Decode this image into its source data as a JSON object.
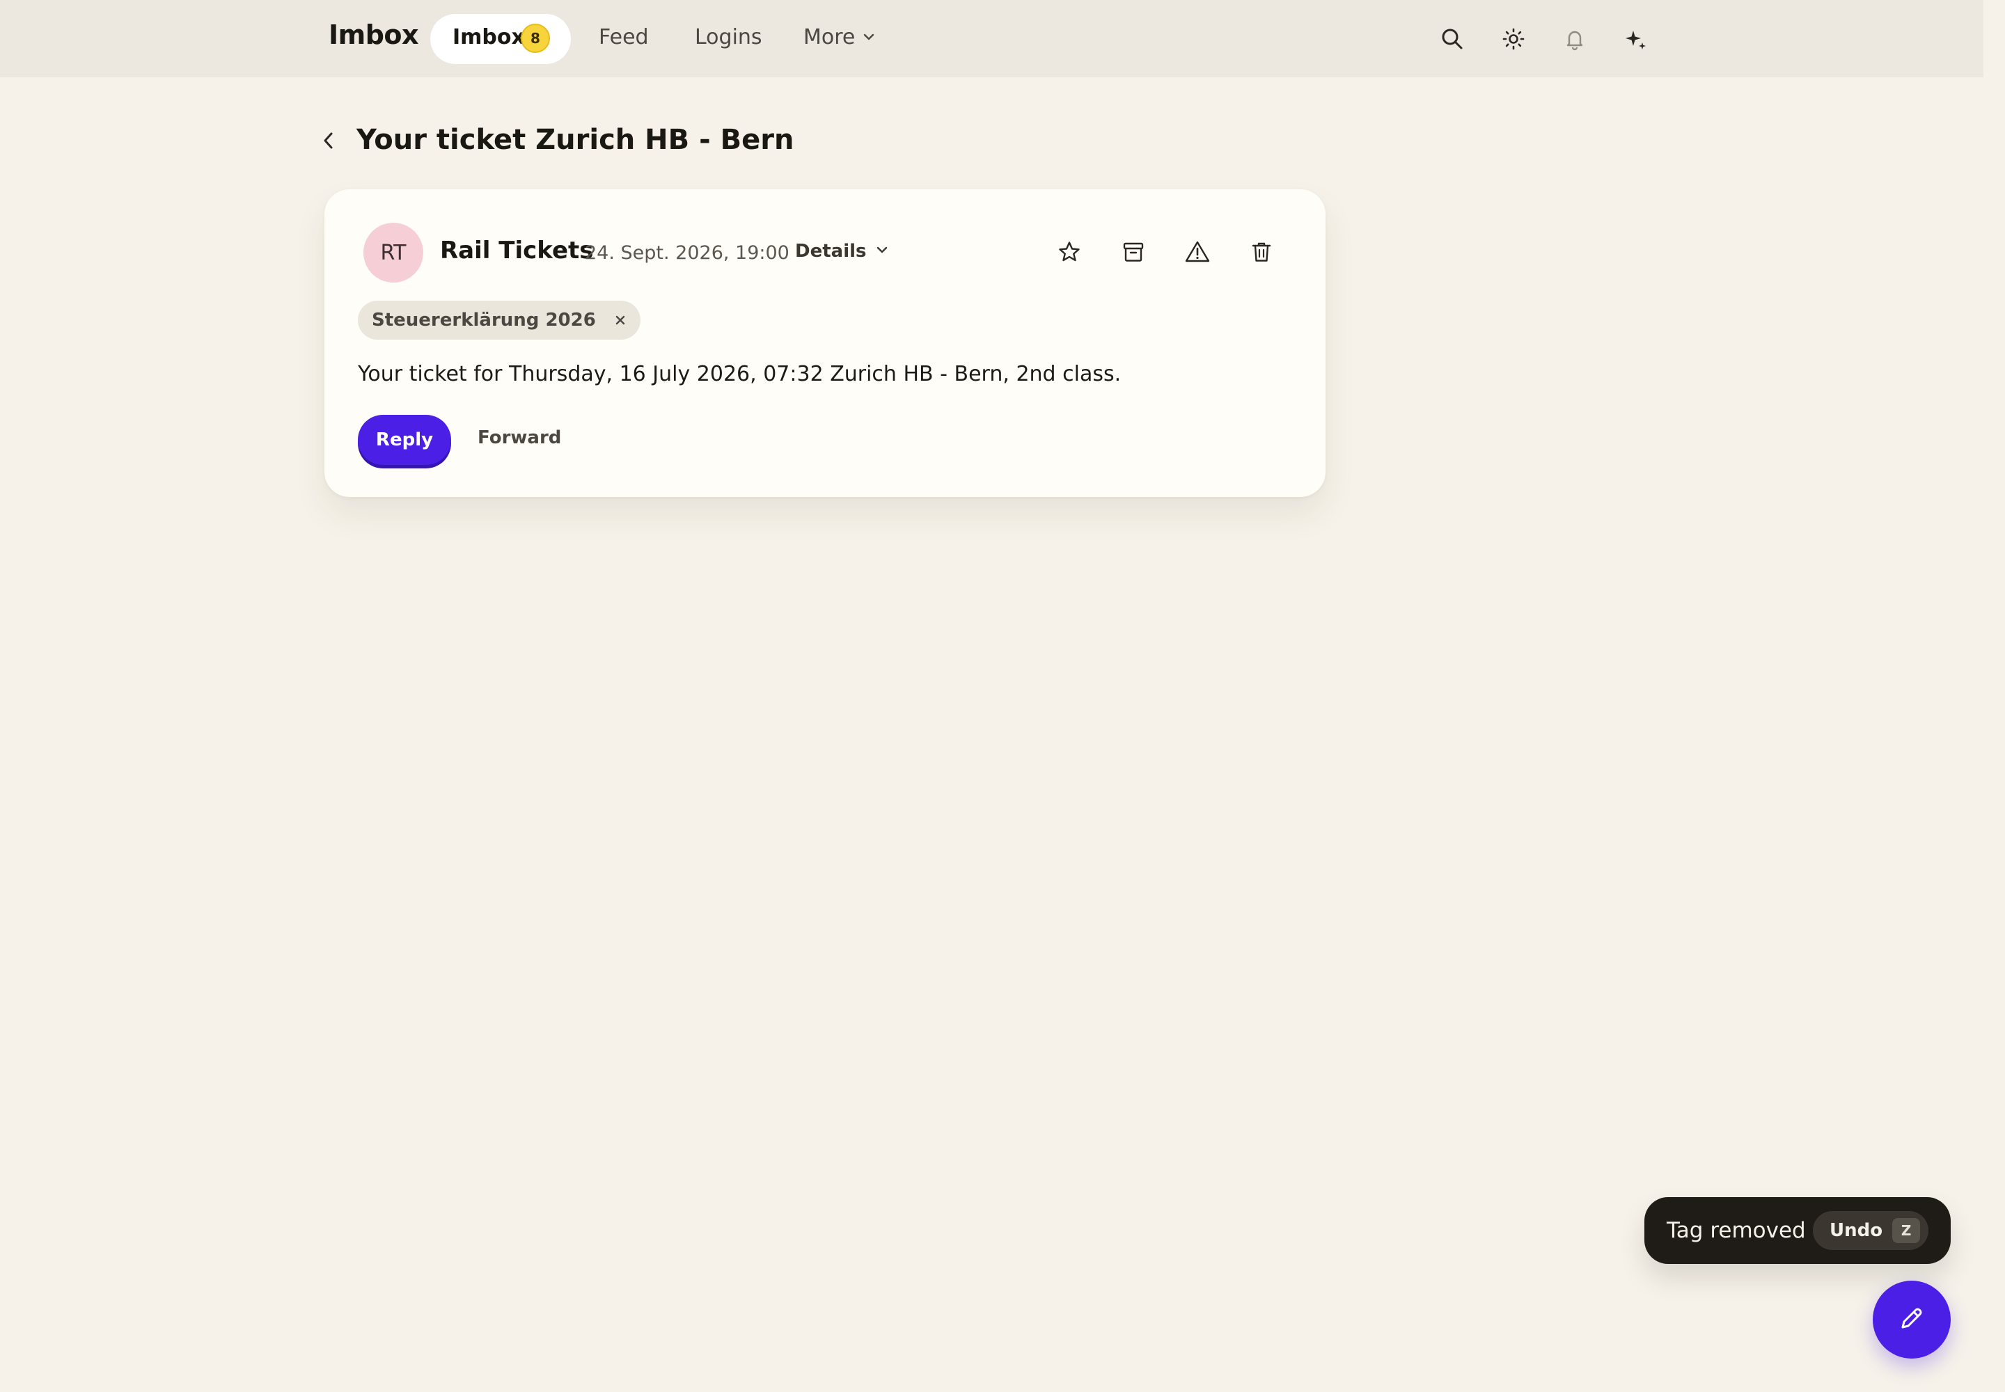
{
  "app": {
    "logo": "Imbox"
  },
  "nav": {
    "items": [
      {
        "label": "Imbox",
        "badge": "8",
        "active": true
      },
      {
        "label": "Feed"
      },
      {
        "label": "Logins"
      },
      {
        "label": "More"
      }
    ],
    "icons": [
      "search-icon",
      "brightness-icon",
      "bell-icon",
      "sparkle-icon"
    ]
  },
  "page": {
    "title": "Your ticket Zurich HB - Bern"
  },
  "message": {
    "avatar_initials": "RT",
    "sender": "Rail Tickets",
    "date": "24. Sept. 2026, 19:00",
    "details_label": "Details",
    "actions": [
      "star-icon",
      "archive-icon",
      "warning-icon",
      "trash-icon"
    ],
    "tag": "Steuererklärung 2026",
    "body": "Your ticket for Thursday, 16 July 2026, 07:32 Zurich HB - Bern, 2nd class.",
    "reply_label": "Reply",
    "forward_label": "Forward"
  },
  "toast": {
    "message": "Tag removed",
    "undo_label": "Undo",
    "shortcut": "Z"
  },
  "colors": {
    "background": "#f6f2e9",
    "topbar": "#ece8df",
    "accent": "#4b1fe6",
    "badge": "#f7d43b",
    "avatar": "#f6cfd6",
    "toast": "#1f1c17"
  }
}
